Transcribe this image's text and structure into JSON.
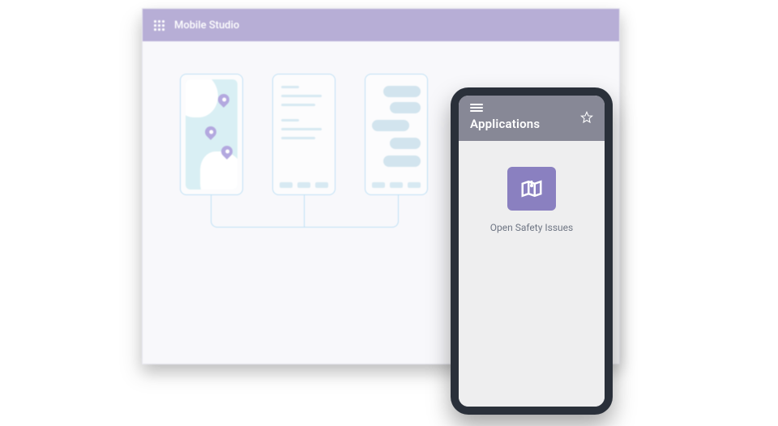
{
  "colors": {
    "header_purple": "#b7aed6",
    "tile_purple": "#8a80c0",
    "phone_header_grey": "#878896",
    "wire_stroke": "#bfe0f5"
  },
  "studio": {
    "title": "Mobile Studio",
    "launcher_icon": "app-grid-icon"
  },
  "phone": {
    "menu_icon": "hamburger-icon",
    "title": "Applications",
    "favorite_icon": "star-outline-icon",
    "tiles": [
      {
        "icon": "map-pin-icon",
        "label": "Open Safety Issues"
      }
    ]
  }
}
